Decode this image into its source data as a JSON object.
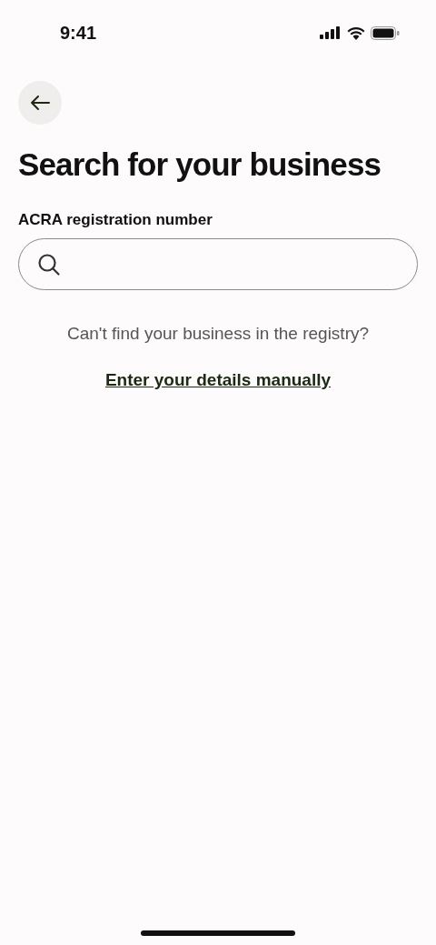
{
  "status_bar": {
    "time": "9:41"
  },
  "title": "Search for your business",
  "search": {
    "label": "ACRA registration number"
  },
  "help_text": "Can't find your business in the registry?",
  "manual_link": "Enter your details manually"
}
